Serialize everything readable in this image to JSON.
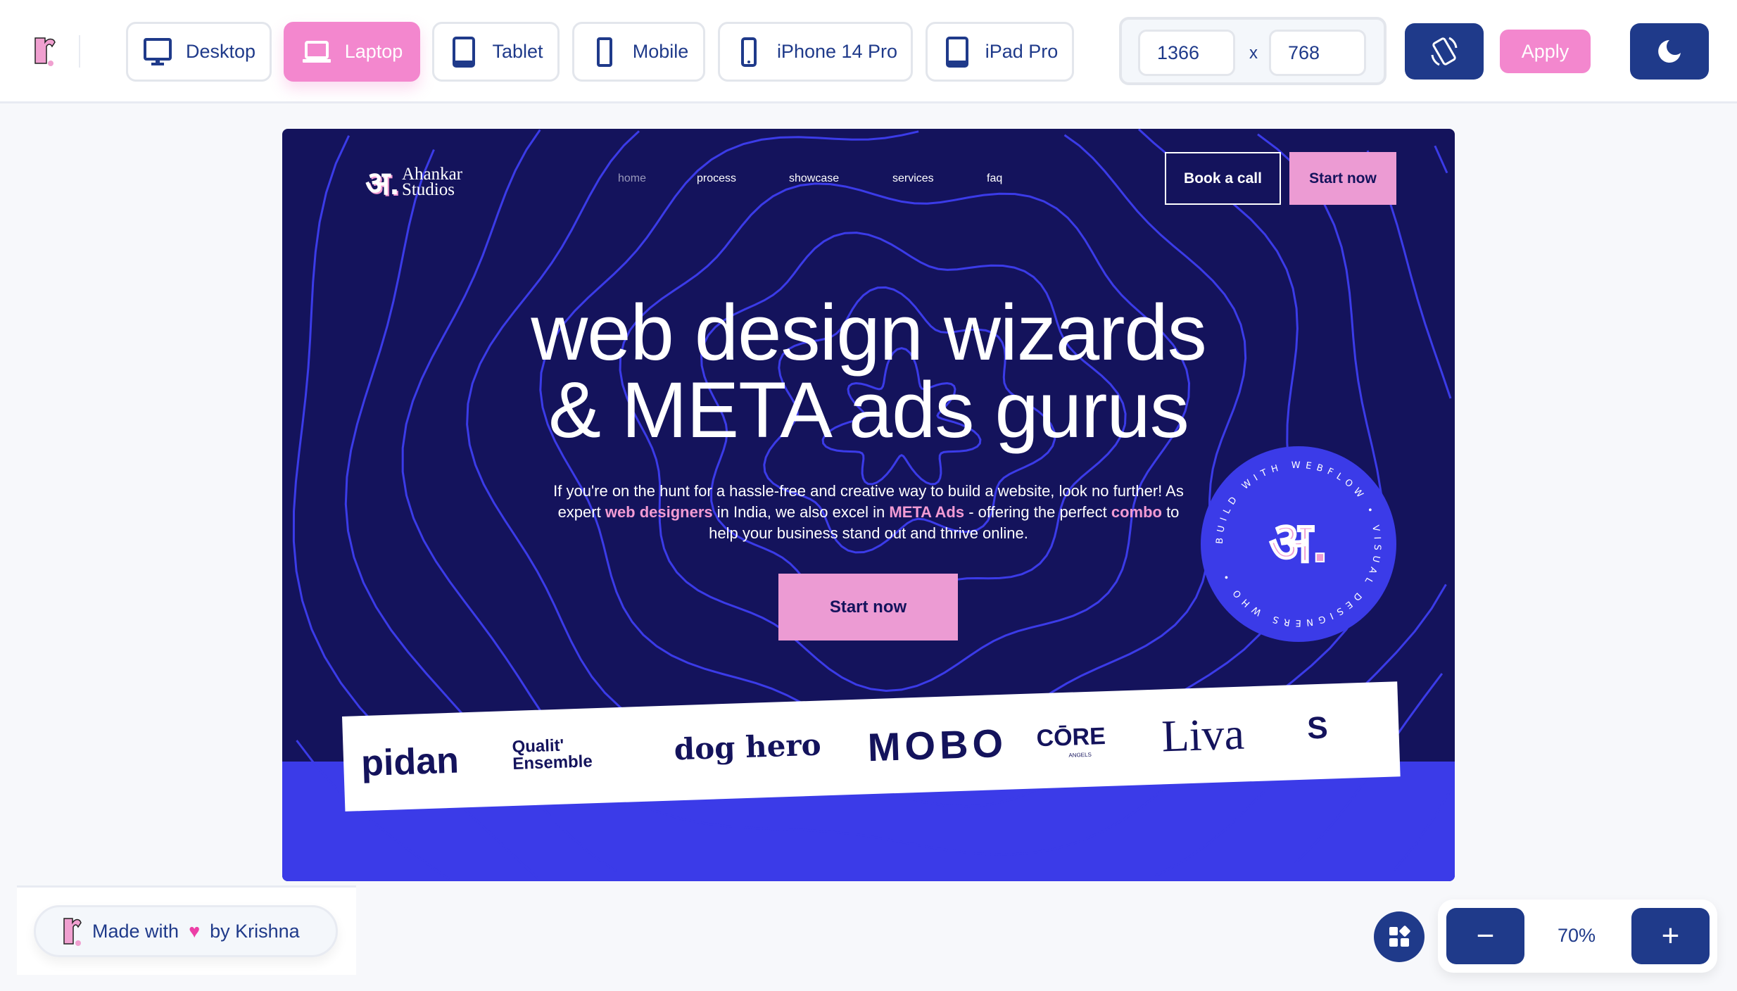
{
  "toolbar": {
    "devices": [
      {
        "label": "Desktop",
        "icon": "desktop-icon",
        "active": false
      },
      {
        "label": "Laptop",
        "icon": "laptop-icon",
        "active": true
      },
      {
        "label": "Tablet",
        "icon": "tablet-icon",
        "active": false
      },
      {
        "label": "Mobile",
        "icon": "mobile-icon",
        "active": false
      },
      {
        "label": "iPhone 14 Pro",
        "icon": "phone-icon",
        "active": false
      },
      {
        "label": "iPad Pro",
        "icon": "tablet-icon",
        "active": false
      }
    ],
    "width": "1366",
    "height": "768",
    "times": "x",
    "apply_label": "Apply"
  },
  "site": {
    "logo_text": [
      "Ahankar",
      "Studios"
    ],
    "nav": [
      "home",
      "process",
      "showcase",
      "services",
      "faq"
    ],
    "book_call": "Book a call",
    "start_now": "Start now",
    "headline_1": "web design wizards",
    "headline_2": "& META ads gurus",
    "para": [
      {
        "t": "If you're on the hunt for a hassle-free and creative way to build a website, look no further! As expert ",
        "h": false
      },
      {
        "t": "web designers",
        "h": true
      },
      {
        "t": " in India, we also excel in ",
        "h": false
      },
      {
        "t": "META Ads",
        "h": true
      },
      {
        "t": " - offering the perfect ",
        "h": false
      },
      {
        "t": "combo",
        "h": true
      },
      {
        "t": " to help your business stand out and thrive online.",
        "h": false
      }
    ],
    "cta": "Start now",
    "badge_text": "BUILD WITH WEBFLOW • VISUAL DESIGNERS WHO •",
    "brands": [
      "pidan",
      "Qualit' Ensemble",
      "dog hero",
      "MOBO",
      "CŌRE",
      "ANGELS",
      "Liva",
      "S"
    ]
  },
  "footer": {
    "made_with": "Made with",
    "by": "by Krishna",
    "zoom": "70%"
  },
  "colors": {
    "navy": "#14135c",
    "accent": "#3b3be8",
    "pink": "#f387ce",
    "ui_navy": "#1f3a8a"
  }
}
